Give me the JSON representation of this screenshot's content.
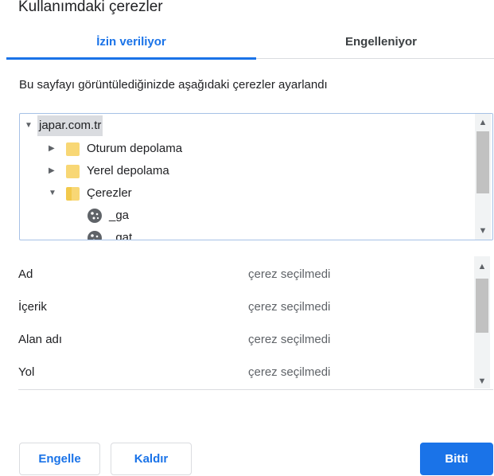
{
  "dialog": {
    "title": "Kullanımdaki çerezler"
  },
  "tabs": [
    {
      "label": "İzin veriliyor",
      "active": true
    },
    {
      "label": "Engelleniyor",
      "active": false
    }
  ],
  "description": "Bu sayfayı görüntülediğinizde aşağıdaki çerezler ayarlandı",
  "tree": {
    "root": "japar.com.tr",
    "items": [
      {
        "label": "Oturum depolama",
        "icon": "folder-icon",
        "expanded": false
      },
      {
        "label": "Yerel depolama",
        "icon": "folder-icon",
        "expanded": false
      },
      {
        "label": "Çerezler",
        "icon": "folder-open-icon",
        "expanded": true
      }
    ],
    "cookies": [
      {
        "label": "_ga",
        "icon": "cookie-icon"
      },
      {
        "label": "_gat",
        "icon": "cookie-icon"
      }
    ]
  },
  "details": [
    {
      "label": "Ad",
      "value": "çerez seçilmedi"
    },
    {
      "label": "İçerik",
      "value": "çerez seçilmedi"
    },
    {
      "label": "Alan adı",
      "value": "çerez seçilmedi"
    },
    {
      "label": "Yol",
      "value": "çerez seçilmedi"
    }
  ],
  "buttons": {
    "block": "Engelle",
    "remove": "Kaldır",
    "done": "Bitti"
  },
  "colors": {
    "accent": "#1a73e8",
    "folder": "#f8d775"
  }
}
